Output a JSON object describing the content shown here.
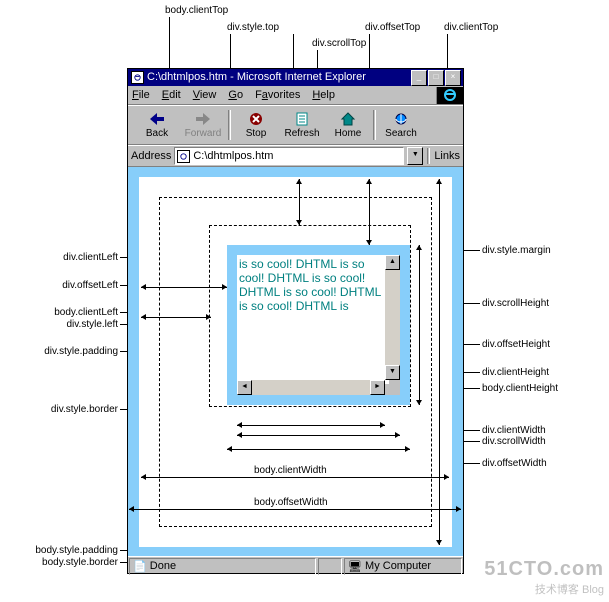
{
  "top_labels": {
    "bodyClientTop": "body.clientTop",
    "divStyleTop": "div.style.top",
    "divScrollTop": "div.scrollTop",
    "divOffsetTop": "div.offsetTop",
    "divClientTop": "div.clientTop"
  },
  "left_labels": {
    "divClientLeft": "div.clientLeft",
    "divOffsetLeft": "div.offsetLeft",
    "bodyClientLeft": "body.clientLeft",
    "divStyleLeft": "div.style.left",
    "divStylePadding": "div.style.padding",
    "divStyleBorder": "div.style.border"
  },
  "right_labels": {
    "divStyleMargin": "div.style.margin",
    "divScrollHeight": "div.scrollHeight",
    "divOffsetHeight": "div.offsetHeight",
    "divClientHeight": "div.clientHeight",
    "bodyClientHeight": "body.clientHeight",
    "divClientWidth": "div.clientWidth",
    "divScrollWidth": "div.scrollWidth",
    "divOffsetWidth": "div.offsetWidth"
  },
  "bottom_labels": {
    "bodyClientWidth": "body.clientWidth",
    "bodyOffsetWidth": "body.offsetWidth",
    "bodyStylePadding": "body.style.padding",
    "bodyStyleBorder": "body.style.border"
  },
  "window": {
    "title": "C:\\dhtmlpos.htm - Microsoft Internet Explorer"
  },
  "menu": {
    "file": "File",
    "edit": "Edit",
    "view": "View",
    "go": "Go",
    "fav": "Favorites",
    "help": "Help"
  },
  "toolbar": {
    "back": "Back",
    "forward": "Forward",
    "stop": "Stop",
    "refresh": "Refresh",
    "home": "Home",
    "search": "Search"
  },
  "address": {
    "label": "Address",
    "value": "C:\\dhtmlpos.htm",
    "links": "Links"
  },
  "content": {
    "text": "is so cool! DHTML is so cool! DHTML is so cool! DHTML is so cool! DHTML is so cool! DHTML is"
  },
  "status": {
    "done": "Done",
    "zone": "My Computer"
  },
  "watermark": {
    "big": "51CTO.com",
    "sm": "技术博客   Blog"
  }
}
